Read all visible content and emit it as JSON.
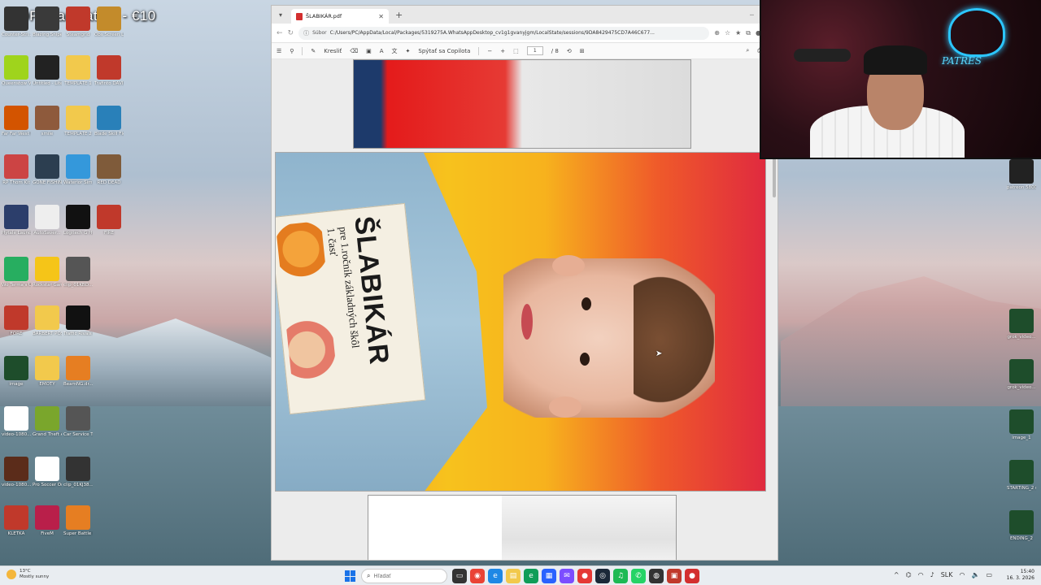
{
  "overlay": {
    "title": "TOPD iampatres - €10"
  },
  "desktop_icons": [
    {
      "label": "Counter-Stri...",
      "color": "#333"
    },
    {
      "label": "Blazing Sniper",
      "color": "#3a3a3a"
    },
    {
      "label": "Steamgrid",
      "color": "#c0392b"
    },
    {
      "label": "Obs Screen Library",
      "color": "#c38b2b"
    },
    {
      "label": "Queenstow Voice Ra...",
      "color": "#9fd41c"
    },
    {
      "label": "Untitled - Literary W...",
      "color": "#222"
    },
    {
      "label": "TEMPLATE 1",
      "color": "#f2c94c"
    },
    {
      "label": "Trafinto DAVIDS",
      "color": "#c0392b"
    },
    {
      "label": "Far Far West Playtest",
      "color": "#d35400"
    },
    {
      "label": "smile",
      "color": "#8e5a3c"
    },
    {
      "label": "TEMPLATE 2",
      "color": "#f2c94c"
    },
    {
      "label": "Blade Skill Fleet Play...",
      "color": "#2980b9"
    },
    {
      "label": "RP Thom Kit",
      "color": "#c44"
    },
    {
      "label": "GONE FISHING",
      "color": "#2c3e50"
    },
    {
      "label": "Waterior Sim. Simulator",
      "color": "#3498db"
    },
    {
      "label": "RED DEAD",
      "color": "#7f5b3a"
    },
    {
      "label": "Hytale Launcher",
      "color": "#2c3e6b"
    },
    {
      "label": "AutoSaver...",
      "color": "#eee"
    },
    {
      "label": "Logitech G HUB",
      "color": "#111"
    },
    {
      "label": "FIRE",
      "color": "#c0392b"
    },
    {
      "label": "Wo Terma's Unknown",
      "color": "#27ae60"
    },
    {
      "label": "Rockstar Games...",
      "color": "#f5c518"
    },
    {
      "label": "clip_01KBD...",
      "color": "#555"
    },
    {
      "label": "FORE",
      "color": "#c0392b"
    },
    {
      "label": "BARBERT POS SI...",
      "color": "#f2c94c"
    },
    {
      "label": "Traffic Rivals Lvl Studio",
      "color": "#111"
    },
    {
      "label": "image",
      "color": "#1e4d2b"
    },
    {
      "label": "EMOTY",
      "color": "#f2c94c"
    },
    {
      "label": "BeamNG.dr...",
      "color": "#e67e22"
    },
    {
      "label": "video-1080...",
      "color": "#fff"
    },
    {
      "label": "Grand Theft Auto V Le...",
      "color": "#7aa62c"
    },
    {
      "label": "Car Service Together",
      "color": "#555"
    },
    {
      "label": "video-1080...",
      "color": "#5b2c1a"
    },
    {
      "label": "Pro Soccer Online",
      "color": "#fff"
    },
    {
      "label": "clip_01KJ38...",
      "color": "#333"
    },
    {
      "label": "KLETKA",
      "color": "#c0392b"
    },
    {
      "label": "FiveM",
      "color": "#b91f4a"
    },
    {
      "label": "Super Battle Golf",
      "color": "#e67e22"
    },
    {
      "label": "patreon 5800...",
      "color": "#222"
    },
    {
      "label": "grok_video...",
      "color": "#1e4d2b"
    },
    {
      "label": "grok_video...",
      "color": "#1e4d2b"
    },
    {
      "label": "image_1",
      "color": "#1e4d2b"
    },
    {
      "label": "STARTING_2 (1)",
      "color": "#1e4d2b"
    },
    {
      "label": "ENDING_2",
      "color": "#1e4d2b"
    }
  ],
  "browser": {
    "tab_title": "ŠLABIKÁR.pdf",
    "site_label": "Súbor",
    "url": "C:/Users/PC/AppData/Local/Packages/5319275A.WhatsAppDesktop_cv1g1gvanyjgm/LocalState/sessions/9DA8429475CD7A46C677...",
    "pdf_toolbar": {
      "draw_label": "Kresliť",
      "copilot_label": "Spýtať sa Copilota",
      "page_current": "1",
      "page_total": "/ 8"
    }
  },
  "book": {
    "title": "ŠLABIKÁR",
    "subtitle_line1": "pre 1.ročník základných škôl",
    "subtitle_line2": "1. časť"
  },
  "webcam": {
    "neon_text": "PATRES"
  },
  "taskbar": {
    "weather_temp": "13°C",
    "weather_desc": "Mostly sunny",
    "search_placeholder": "Hľadať",
    "lang": "SLK",
    "time": "15:40",
    "date": "16. 3. 2026"
  }
}
